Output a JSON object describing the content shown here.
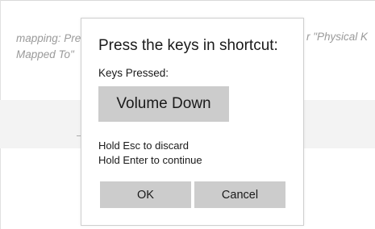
{
  "background": {
    "line1": "mapping: Pre",
    "line2": "Mapped To\"",
    "right_text": "r \"Physical K"
  },
  "dialog": {
    "title": "Press the keys in shortcut:",
    "keys_label": "Keys Pressed:",
    "pressed_key": "Volume Down",
    "hint_discard": "Hold Esc to discard",
    "hint_continue": "Hold Enter to continue",
    "ok_label": "OK",
    "cancel_label": "Cancel"
  },
  "colors": {
    "chip_bg": "#cccccc",
    "button_bg": "#cccccc",
    "muted_text": "#9a9a9a"
  }
}
